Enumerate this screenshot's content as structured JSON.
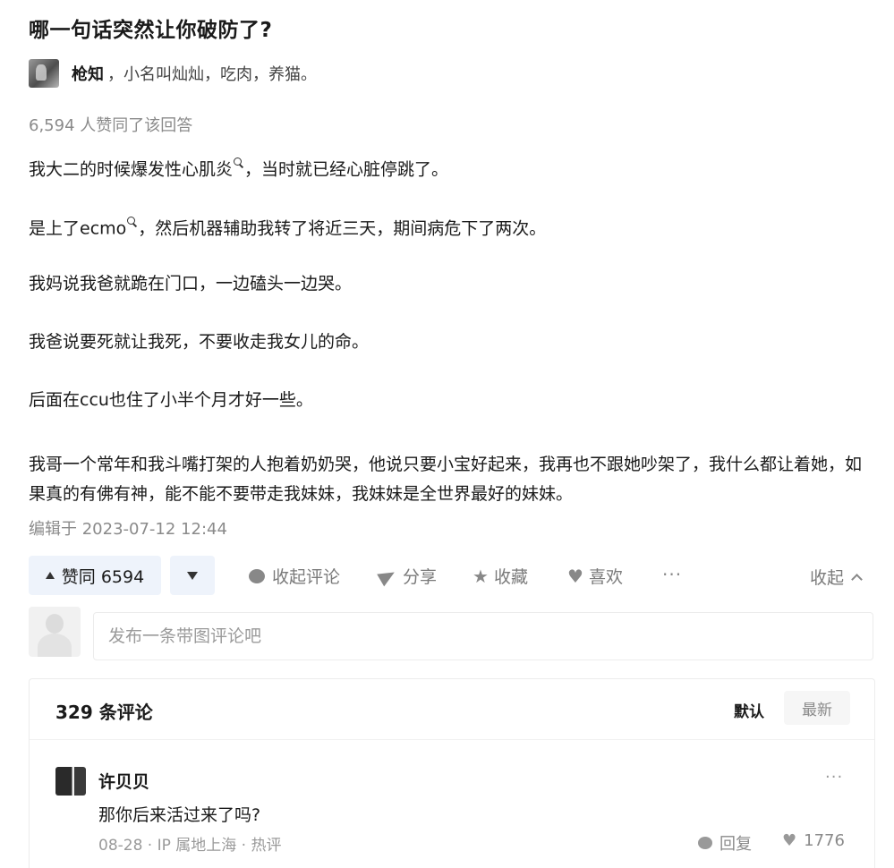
{
  "question": {
    "title": "哪一句话突然让你破防了?"
  },
  "author": {
    "name": "枪知",
    "bio": "，小名叫灿灿，吃肉，养猫。"
  },
  "answer": {
    "votes_text": "6,594 人赞同了该回答",
    "paragraphs": [
      {
        "before": "我大二的时候爆发性心肌炎",
        "after": "，当时就已经心脏停跳了。"
      },
      {
        "before": "是上了ecmo",
        "after": "，然后机器辅助我转了将近三天，期间病危下了两次。"
      },
      {
        "text": "我妈说我爸就跪在门口，一边磕头一边哭。"
      },
      {
        "text": "我爸说要死就让我死，不要收走我女儿的命。"
      },
      {
        "text": "后面在ccu也住了小半个月才好一些。"
      },
      {
        "text": "我哥一个常年和我斗嘴打架的人抱着奶奶哭，他说只要小宝好起来，我再也不跟她吵架了，我什么都让着她，如果真的有佛有神，能不能不要带走我妹妹，我妹妹是全世界最好的妹妹。"
      }
    ],
    "edited": "编辑于 2023-07-12 12:44"
  },
  "actions": {
    "upvote": "赞同 6594",
    "comments": "收起评论",
    "share": "分享",
    "favorite": "收藏",
    "like": "喜欢",
    "more": "···",
    "collapse": "收起"
  },
  "comment_box": {
    "placeholder": "发布一条带图评论吧"
  },
  "comments": {
    "count": "329 条评论",
    "sort_default": "默认",
    "sort_latest": "最新",
    "items": [
      {
        "user": "许贝贝",
        "text": "那你后来活过来了吗?",
        "meta": "08-28 · IP 属地上海 · 热评",
        "reply": "回复",
        "likes": "1776",
        "more": "···"
      }
    ]
  },
  "icons": {
    "search": "search-icon",
    "upvote": "triangle-up-icon",
    "downvote": "triangle-down-icon",
    "comment": "comment-bubble-icon",
    "share": "paper-plane-icon",
    "favorite": "star-icon",
    "like": "heart-icon",
    "collapse": "chevron-up-icon"
  }
}
